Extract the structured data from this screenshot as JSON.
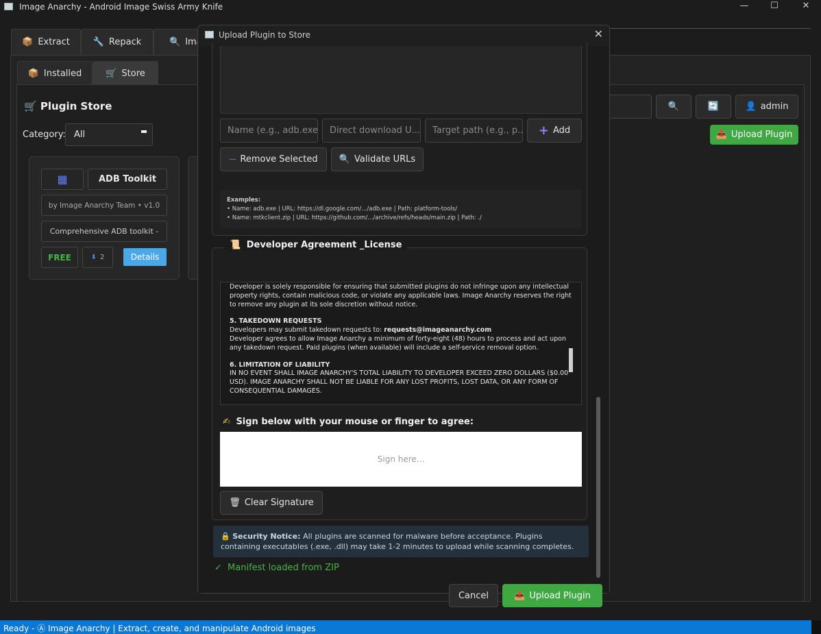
{
  "window": {
    "title": "Image Anarchy - Android Image Swiss Army Knife",
    "minimize": "—",
    "maximize": "☐",
    "close": "✕"
  },
  "main_tabs": [
    {
      "icon": "📦",
      "label": "Extract"
    },
    {
      "icon": "🔧",
      "label": "Repack"
    },
    {
      "icon": "🔍",
      "label": "Ima"
    }
  ],
  "sub_tabs": [
    {
      "icon": "📦",
      "label": "Installed"
    },
    {
      "icon": "🛒",
      "label": "Store"
    }
  ],
  "store": {
    "icon": "🛒",
    "title": "Plugin Store",
    "category_label": "Category:",
    "category_value": "All",
    "search_icon": "🔍",
    "refresh_icon": "🔄",
    "user_icon": "👤",
    "user_label": "admin",
    "upload_icon": "📤",
    "upload_label": "Upload Plugin"
  },
  "card": {
    "icon": "▦",
    "name": "ADB Toolkit",
    "author": "by Image Anarchy Team • v1.0",
    "description": "Comprehensive ADB toolkit -",
    "price": "FREE",
    "downloads_icon": "⬇",
    "downloads": "2",
    "details_label": "Details"
  },
  "dialog": {
    "title": "Upload Plugin to Store",
    "close": "✕",
    "name_placeholder": "Name (e.g., adb.exe)",
    "url_placeholder": "Direct download U...",
    "path_placeholder": "Target path (e.g., p...",
    "add_icon": "+",
    "add_label": "Add",
    "remove_icon": "—",
    "remove_label": "Remove Selected",
    "validate_icon": "🔍",
    "validate_label": "Validate URLs",
    "examples_title": "Examples:",
    "example1": "• Name: adb.exe | URL: https://dl.google.com/.../adb.exe | Path: platform-tools/",
    "example2": "• Name: mtkclient.zip | URL: https://github.com/.../archive/refs/heads/main.zip | Path: ./",
    "agreement_icon": "📜",
    "agreement_title": "Developer Agreement _License",
    "license_p1": "Developer is solely responsible for ensuring that submitted plugins do not infringe upon any intellectual property rights, contain malicious code, or violate any applicable laws. Image Anarchy reserves the right to remove any plugin at its sole discretion without notice.",
    "license_h5": "5. TAKEDOWN REQUESTS",
    "license_p5a": "Developers may submit takedown requests to: ",
    "license_email": "requests@imageanarchy.com",
    "license_p5b": "Developer agrees to allow Image Anarchy a minimum of forty-eight (48) hours to process and act upon any takedown request. Paid plugins (when available) will include a self-service removal option.",
    "license_h6": "6. LIMITATION OF LIABILITY",
    "license_p6": "IN NO EVENT SHALL IMAGE ANARCHY'S TOTAL LIABILITY TO DEVELOPER EXCEED ZERO DOLLARS ($0.00 USD). IMAGE ANARCHY SHALL NOT BE LIABLE FOR ANY LOST PROFITS, LOST DATA, OR ANY FORM OF CONSEQUENTIAL DAMAGES.",
    "sign_icon": "✍",
    "sign_label": "Sign below with your mouse or finger to agree:",
    "sign_placeholder": "Sign here...",
    "clear_icon": "🗑",
    "clear_label": "Clear Signature",
    "notice_icon": "🔒",
    "notice_bold": "Security Notice:",
    "notice_text": " All plugins are scanned for malware before acceptance. Plugins containing executables (.exe, .dll) may take 1-2 minutes to upload while scanning completes.",
    "manifest_icon": "✓",
    "manifest_text": "Manifest loaded from ZIP",
    "cancel_label": "Cancel",
    "upload_icon": "📤",
    "upload_label": "Upload Plugin"
  },
  "status": {
    "text": "Ready - Ⓐ Image Anarchy | Extract, create, and manipulate Android images"
  }
}
